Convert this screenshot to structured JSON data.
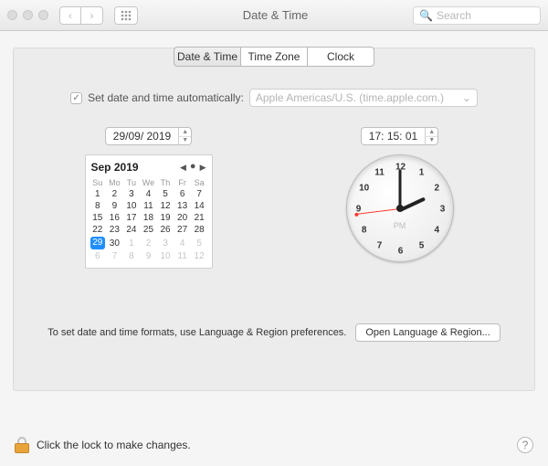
{
  "window": {
    "title": "Date & Time",
    "search_placeholder": "Search"
  },
  "tabs": {
    "date_time": "Date & Time",
    "time_zone": "Time Zone",
    "clock": "Clock",
    "active": 0
  },
  "auto": {
    "checked": true,
    "label": "Set date and time automatically:",
    "server": "Apple Americas/U.S. (time.apple.com.)"
  },
  "date_stepper": "29/09/ 2019",
  "time_stepper": "17: 15: 01",
  "calendar": {
    "month_label": "Sep 2019",
    "dow": [
      "Su",
      "Mo",
      "Tu",
      "We",
      "Th",
      "Fr",
      "Sa"
    ],
    "weeks": [
      [
        {
          "d": 1
        },
        {
          "d": 2
        },
        {
          "d": 3
        },
        {
          "d": 4
        },
        {
          "d": 5
        },
        {
          "d": 6
        },
        {
          "d": 7
        }
      ],
      [
        {
          "d": 8
        },
        {
          "d": 9
        },
        {
          "d": 10
        },
        {
          "d": 11
        },
        {
          "d": 12
        },
        {
          "d": 13
        },
        {
          "d": 14
        }
      ],
      [
        {
          "d": 15
        },
        {
          "d": 16
        },
        {
          "d": 17
        },
        {
          "d": 18
        },
        {
          "d": 19
        },
        {
          "d": 20
        },
        {
          "d": 21
        }
      ],
      [
        {
          "d": 22
        },
        {
          "d": 23
        },
        {
          "d": 24
        },
        {
          "d": 25
        },
        {
          "d": 26
        },
        {
          "d": 27
        },
        {
          "d": 28
        }
      ],
      [
        {
          "d": 29,
          "sel": true
        },
        {
          "d": 30
        },
        {
          "d": 1,
          "dim": true
        },
        {
          "d": 2,
          "dim": true
        },
        {
          "d": 3,
          "dim": true
        },
        {
          "d": 4,
          "dim": true
        },
        {
          "d": 5,
          "dim": true
        }
      ],
      [
        {
          "d": 6,
          "dim": true
        },
        {
          "d": 7,
          "dim": true
        },
        {
          "d": 8,
          "dim": true
        },
        {
          "d": 9,
          "dim": true
        },
        {
          "d": 10,
          "dim": true
        },
        {
          "d": 11,
          "dim": true
        },
        {
          "d": 12,
          "dim": true
        }
      ]
    ]
  },
  "clock": {
    "ampm": "PM",
    "hour_angle": 65,
    "minute_angle": 0,
    "second_angle": -97,
    "numbers": [
      "12",
      "1",
      "2",
      "3",
      "4",
      "5",
      "6",
      "7",
      "8",
      "9",
      "10",
      "11"
    ]
  },
  "footer": {
    "note": "To set date and time formats, use Language & Region preferences.",
    "button": "Open Language & Region..."
  },
  "lockbar": {
    "text": "Click the lock to make changes."
  }
}
